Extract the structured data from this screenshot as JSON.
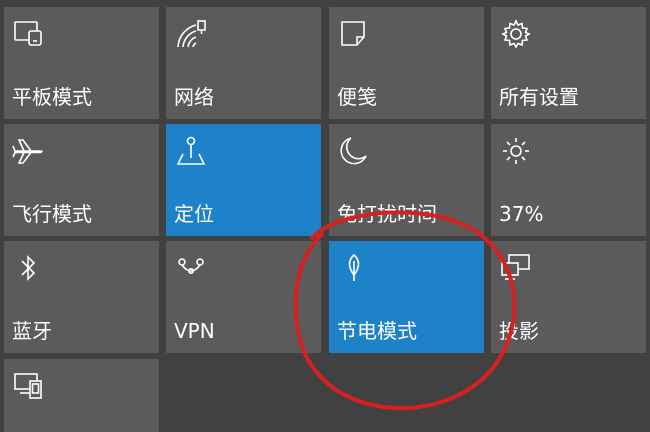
{
  "tiles": [
    {
      "label": "平板模式",
      "icon": "tablet-mode-icon",
      "active": false
    },
    {
      "label": "网络",
      "icon": "network-icon",
      "active": false
    },
    {
      "label": "便笺",
      "icon": "note-icon",
      "active": false
    },
    {
      "label": "所有设置",
      "icon": "gear-icon",
      "active": false
    },
    {
      "label": "飞行模式",
      "icon": "airplane-icon",
      "active": false
    },
    {
      "label": "定位",
      "icon": "location-icon",
      "active": true
    },
    {
      "label": "免打扰时间",
      "icon": "moon-icon",
      "active": false
    },
    {
      "label": "37%",
      "icon": "brightness-icon",
      "active": false
    },
    {
      "label": "蓝牙",
      "icon": "bluetooth-icon",
      "active": false
    },
    {
      "label": "VPN",
      "icon": "vpn-icon",
      "active": false
    },
    {
      "label": "节电模式",
      "icon": "battery-saver-leaf-icon",
      "active": true
    },
    {
      "label": "投影",
      "icon": "project-icon",
      "active": false
    },
    {
      "label": "",
      "icon": "connect-devices-icon",
      "active": false
    }
  ],
  "colors": {
    "background": "#414141",
    "tile": "#5b5b5b",
    "tile_active": "#1e82c9",
    "annotation": "#d92020"
  }
}
